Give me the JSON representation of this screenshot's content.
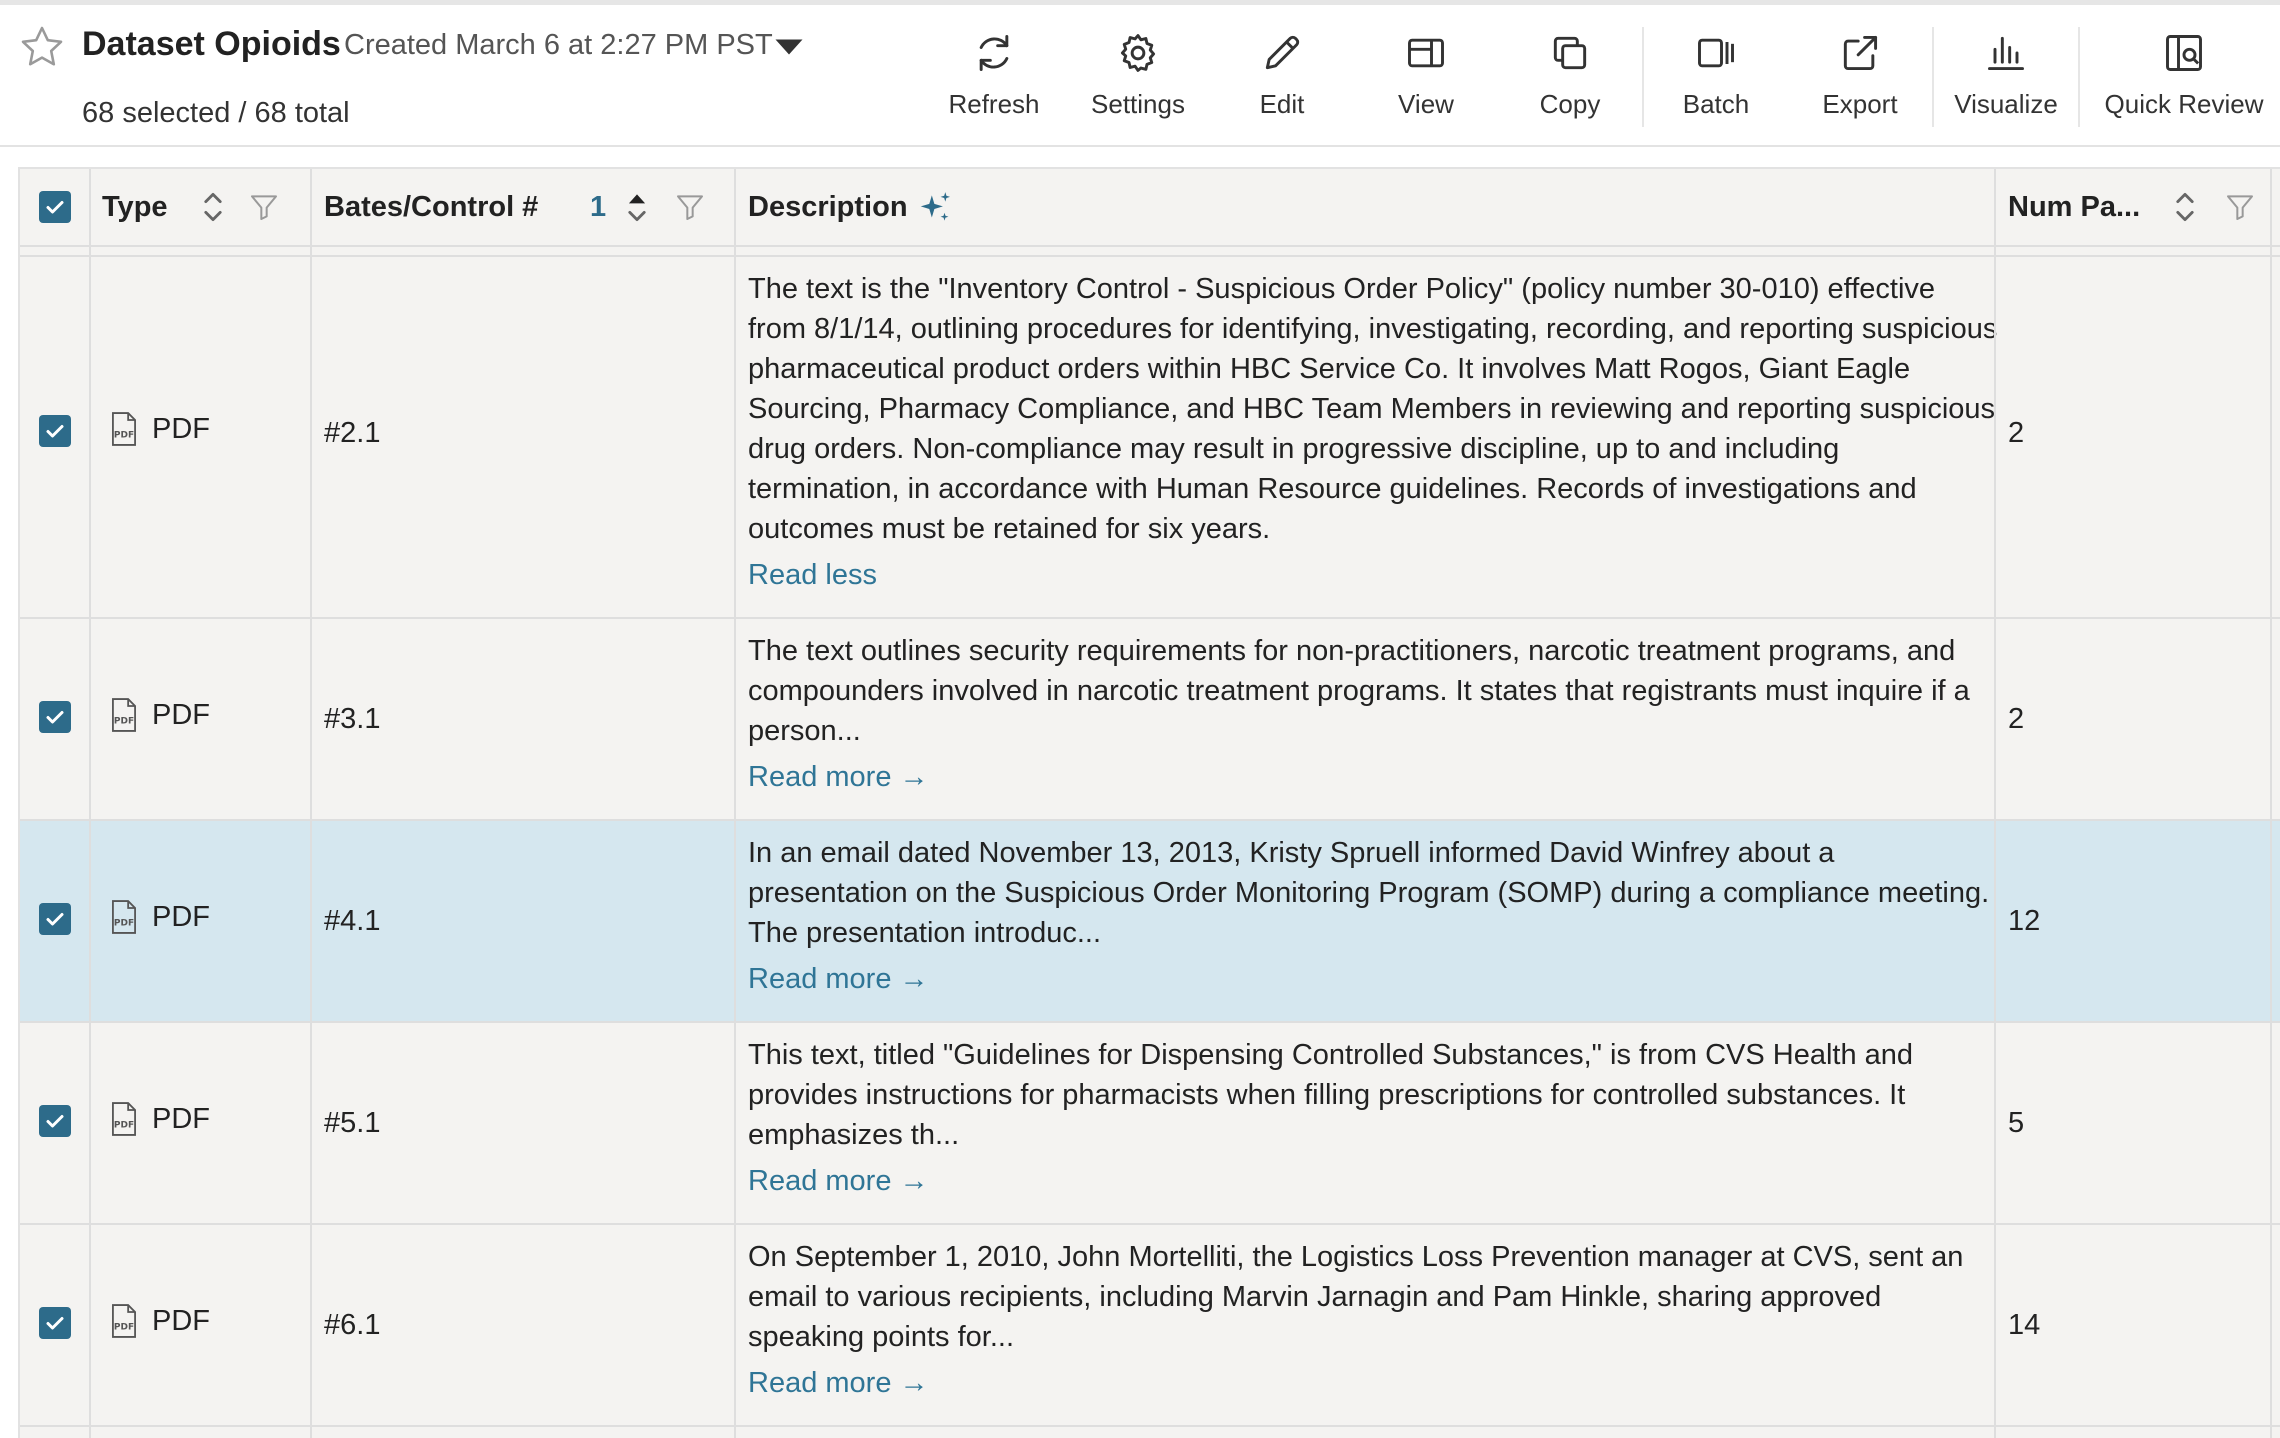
{
  "dataset": {
    "title": "Dataset Opioids",
    "created": "Created March 6 at 2:27 PM PST",
    "count": "68 selected / 68 total"
  },
  "toolbar": {
    "refresh": "Refresh",
    "settings": "Settings",
    "edit": "Edit",
    "view": "View",
    "copy": "Copy",
    "batch": "Batch",
    "export": "Export",
    "visualize": "Visualize",
    "quick_review": "Quick Review"
  },
  "columns": {
    "type": "Type",
    "bates": "Bates/Control #",
    "bates_sort_index": "1",
    "description": "Description",
    "num_pages": "Num Pa..."
  },
  "colors": {
    "accent": "#2d6b8a",
    "link": "#2f7596",
    "highlight_row": "#d5e7ef",
    "table_bg": "#f4f3f1"
  },
  "rows": [
    {
      "type": "PDF",
      "bates": "#2.1",
      "description": "The text is the \"Inventory Control - Suspicious Order Policy\" (policy number 30-010) effective from 8/1/14, outlining procedures for identifying, investigating, recording, and reporting suspicious pharmaceutical product orders within HBC Service Co. It involves Matt Rogos, Giant Eagle Sourcing, Pharmacy Compliance, and HBC Team Members in reviewing and reporting suspicious drug orders. Non-compliance may result in progressive discipline, up to and including termination, in accordance with Human Resource guidelines. Records of investigations and outcomes must be retained for six years.",
      "link": "Read less",
      "pages": "2"
    },
    {
      "type": "PDF",
      "bates": "#3.1",
      "description": "The text outlines security requirements for non-practitioners, narcotic treatment programs, and compounders involved in narcotic treatment programs. It states that registrants must inquire if a person...",
      "link": "Read more →",
      "pages": "2"
    },
    {
      "type": "PDF",
      "bates": "#4.1",
      "description": "In an email dated November 13, 2013, Kristy Spruell informed David Winfrey about a presentation on the Suspicious Order Monitoring Program (SOMP) during a compliance meeting. The presentation introduc...",
      "link": "Read more →",
      "pages": "12"
    },
    {
      "type": "PDF",
      "bates": "#5.1",
      "description": "This text, titled \"Guidelines for Dispensing Controlled Substances,\" is from CVS Health and provides instructions for pharmacists when filling prescriptions for controlled substances. It emphasizes th...",
      "link": "Read more →",
      "pages": "5"
    },
    {
      "type": "PDF",
      "bates": "#6.1",
      "description": "On September 1, 2010, John Mortelliti, the Logistics Loss Prevention manager at CVS, sent an email to various recipients, including Marvin Jarnagin and Pam Hinkle, sharing approved speaking points for...",
      "link": "Read more →",
      "pages": "14"
    }
  ]
}
